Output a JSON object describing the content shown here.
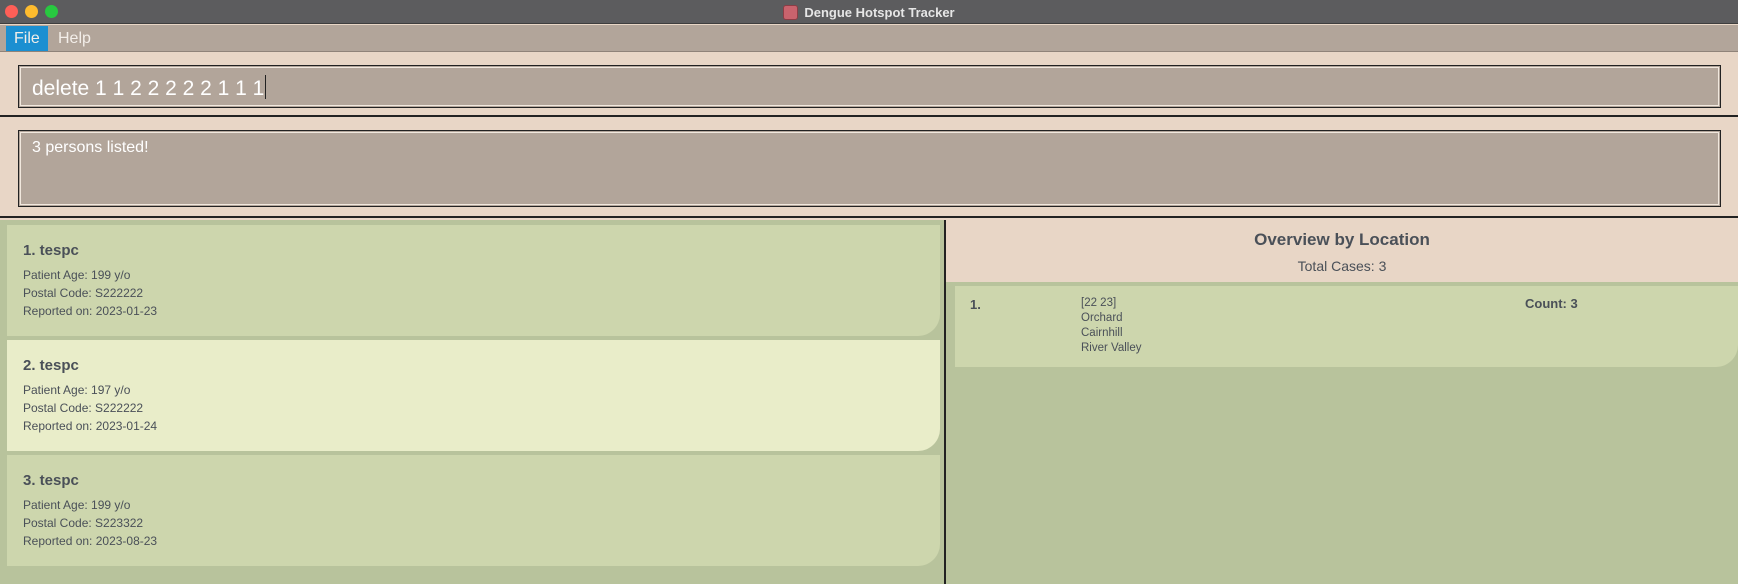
{
  "window": {
    "title": "Dengue Hotspot Tracker",
    "app_icon": "virus-app-icon"
  },
  "menubar": {
    "items": [
      {
        "label": "File",
        "active": true
      },
      {
        "label": "Help",
        "active": false
      }
    ]
  },
  "command": {
    "value": "delete 1 1 2 2 2 2 2 1 1 1"
  },
  "result": {
    "message": "3 persons listed!"
  },
  "persons": [
    {
      "title": "1. tespc",
      "age": "Patient Age: 199 y/o",
      "postal": "Postal Code: S222222",
      "reported": "Reported on: 2023-01-23",
      "selected": false
    },
    {
      "title": "2. tespc",
      "age": "Patient Age: 197 y/o",
      "postal": "Postal Code: S222222",
      "reported": "Reported on: 2023-01-24",
      "selected": true
    },
    {
      "title": "3. tespc",
      "age": "Patient Age: 199 y/o",
      "postal": "Postal Code: S223322",
      "reported": "Reported on: 2023-08-23",
      "selected": false
    }
  ],
  "overview": {
    "title": "Overview by Location",
    "total": "Total Cases: 3",
    "items": [
      {
        "index": "1.",
        "names": [
          "[22 23]",
          "Orchard",
          "Cairnhill",
          "River Valley"
        ],
        "count": "Count: 3"
      }
    ]
  },
  "colors": {
    "accent": "#1b8fd1",
    "panel": "#b8c39c",
    "card": "#cdd6ad",
    "card_selected": "#e9edc9",
    "header_bg": "#e8d6c6",
    "box_bg": "#b2a59a"
  }
}
